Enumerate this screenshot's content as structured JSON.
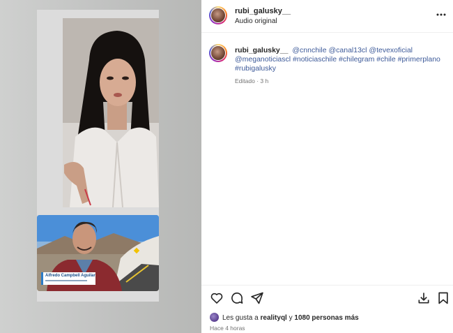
{
  "post": {
    "username": "rubi_galusky__",
    "audio": "Audio original"
  },
  "caption": {
    "username": "rubi_galusky__",
    "text": "@cnnchile @canal13cl @tevexoficial @meganoticiascl #noticiaschile #chilegram #chile #primerplano #rubigalusky",
    "meta": "Editado · 3 h"
  },
  "video": {
    "lower_third_name": "Alfredo Campbell Aguilar"
  },
  "likes": {
    "prefix": "Les gusta a ",
    "first_user": "realityql",
    "connector": " y ",
    "others": "1080 personas más"
  },
  "timestamp": "Hace 4 horas",
  "icons": {
    "more": "more-horizontal-icon",
    "like": "heart-icon",
    "comment": "comment-icon",
    "share": "share-icon",
    "save": "save-icon",
    "download": "download-icon"
  }
}
